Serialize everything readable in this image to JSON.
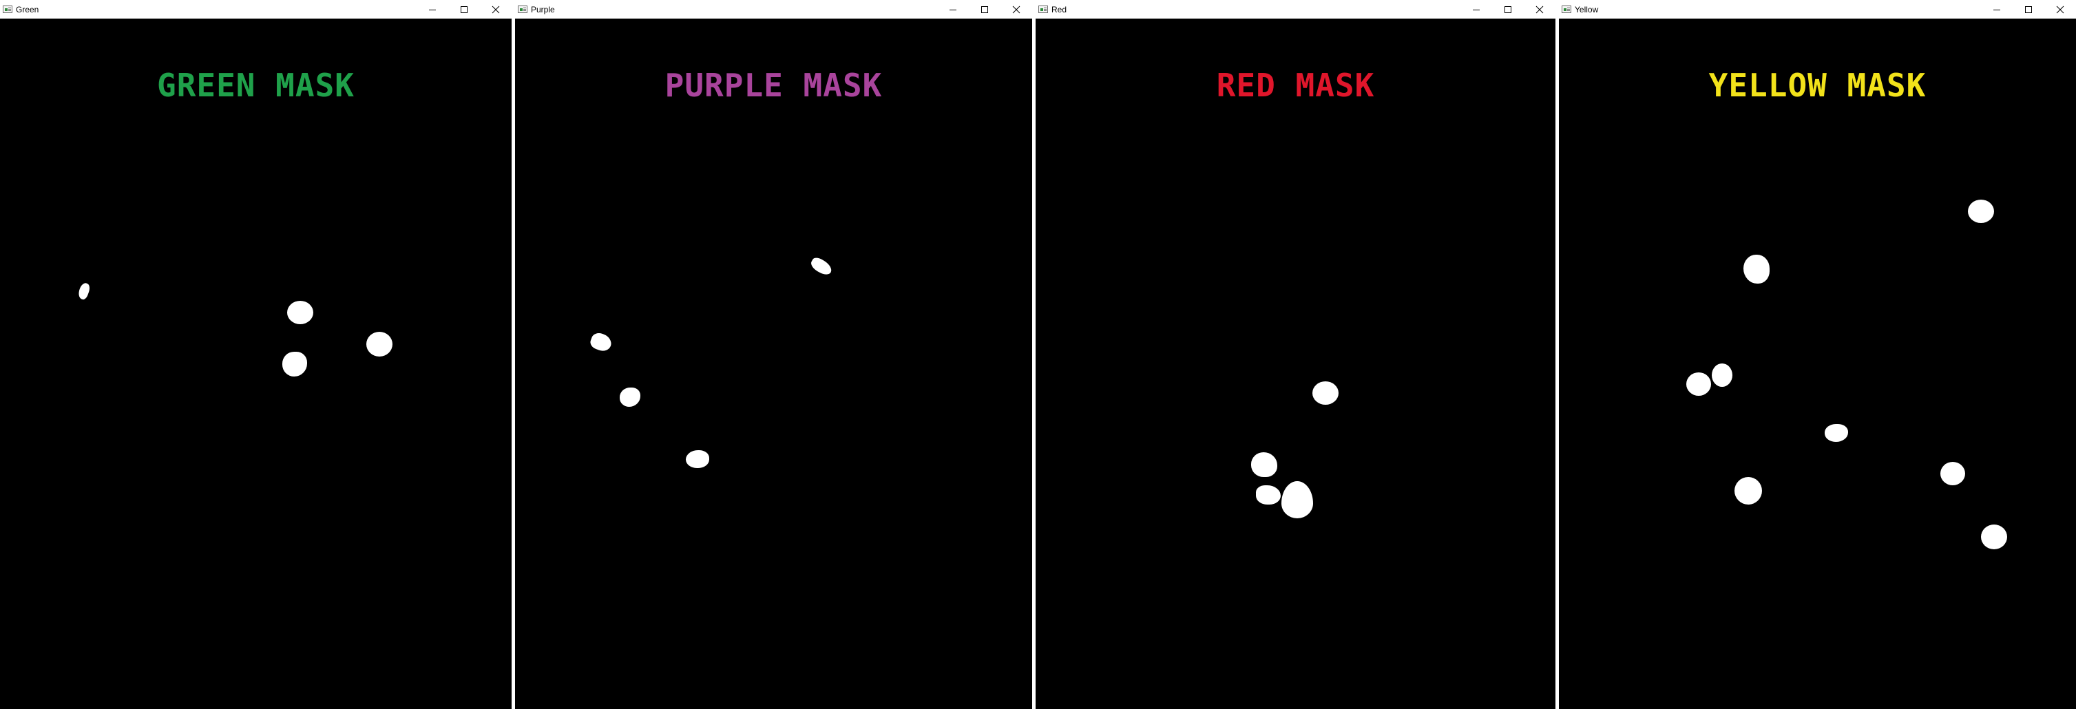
{
  "windows": [
    {
      "title": "Green",
      "mask_label": "GREEN MASK",
      "label_color": "#1fa14a",
      "icon": "opencv-window-icon"
    },
    {
      "title": "Purple",
      "mask_label": "PURPLE MASK",
      "label_color": "#a9449c",
      "icon": "opencv-window-icon"
    },
    {
      "title": "Red",
      "mask_label": "RED MASK",
      "label_color": "#e0162b",
      "icon": "opencv-window-icon"
    },
    {
      "title": "Yellow",
      "mask_label": "YELLOW MASK",
      "label_color": "#f2e21a",
      "icon": "opencv-window-icon"
    }
  ],
  "controls": {
    "minimize_icon": "minimize-icon",
    "maximize_icon": "maximize-icon",
    "close_icon": "close-icon"
  }
}
